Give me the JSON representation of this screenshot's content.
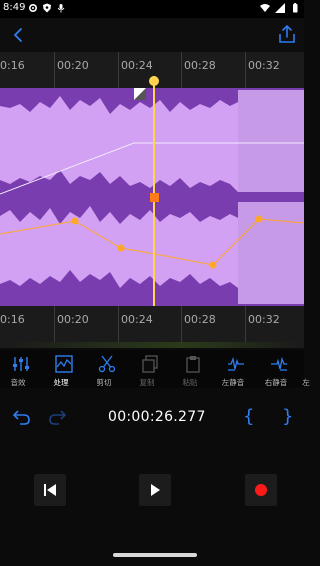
{
  "status_bar": {
    "time": "8:49"
  },
  "ruler": {
    "ticks": [
      "0:16",
      "00:20",
      "00:24",
      "00:28",
      "00:32"
    ]
  },
  "toolbar": {
    "items": [
      {
        "label": "音效",
        "icon": "sliders-icon"
      },
      {
        "label": "处理",
        "icon": "waveform-process-icon"
      },
      {
        "label": "剪切",
        "icon": "scissors-icon"
      },
      {
        "label": "复制",
        "icon": "copy-icon"
      },
      {
        "label": "粘贴",
        "icon": "paste-icon"
      },
      {
        "label": "左静音",
        "icon": "mute-left-icon"
      },
      {
        "label": "右静音",
        "icon": "mute-right-icon"
      },
      {
        "label": "左",
        "icon": "more-icon"
      }
    ]
  },
  "controls": {
    "time": "00:00:26.277",
    "left_bracket": "{",
    "right_bracket": "}"
  },
  "colors": {
    "waveform_bg": "#7a3db0",
    "waveform_light": "#d7a6f7",
    "accent_blue": "#2f7df0",
    "playhead": "#ffd54f",
    "envelope": "#ffa726",
    "record": "#ff1a1a"
  }
}
